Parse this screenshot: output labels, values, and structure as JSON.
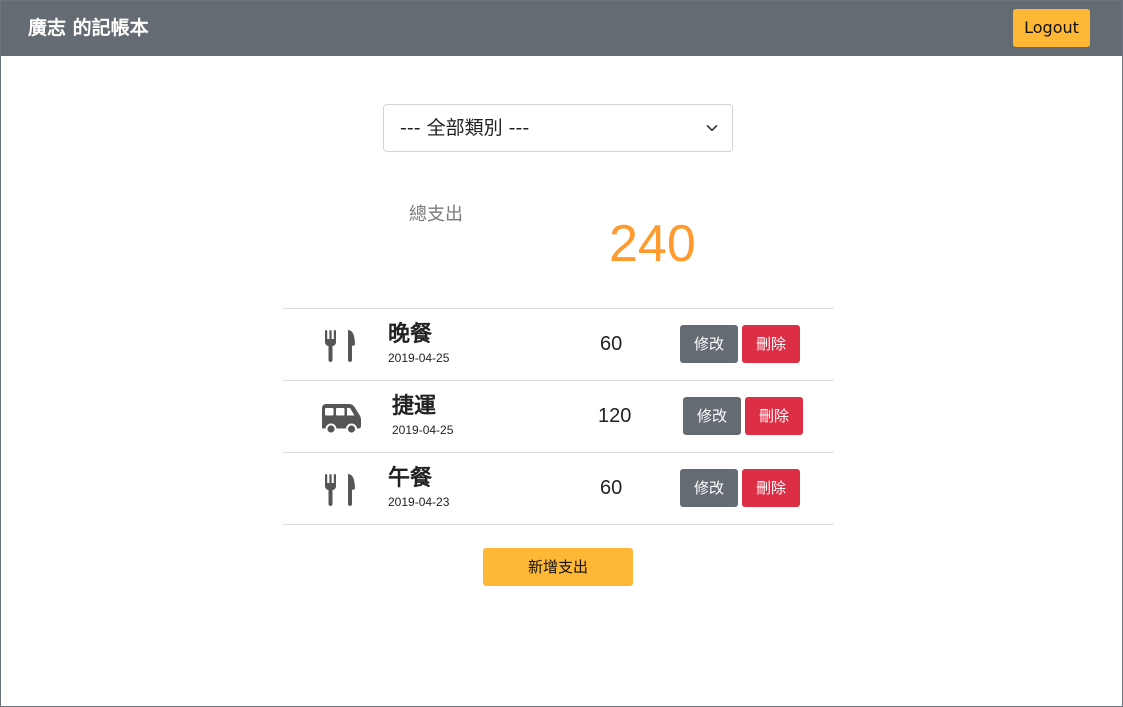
{
  "navbar": {
    "title": "廣志 的記帳本",
    "logout_label": "Logout"
  },
  "filter": {
    "selected": "--- 全部類別 ---"
  },
  "summary": {
    "label": "總支出",
    "total": "240"
  },
  "records": [
    {
      "icon": "utensils-icon",
      "name": "晚餐",
      "date": "2019-04-25",
      "amount": "60"
    },
    {
      "icon": "shuttle-van-icon",
      "name": "捷運",
      "date": "2019-04-25",
      "amount": "120"
    },
    {
      "icon": "utensils-icon",
      "name": "午餐",
      "date": "2019-04-23",
      "amount": "60"
    }
  ],
  "actions": {
    "edit_label": "修改",
    "delete_label": "刪除",
    "add_label": "新增支出"
  },
  "colors": {
    "navbar": "#646b72",
    "accent": "#ffb836",
    "total": "#ff9a2e",
    "danger": "#dc2f45",
    "secondary": "#646b72"
  }
}
